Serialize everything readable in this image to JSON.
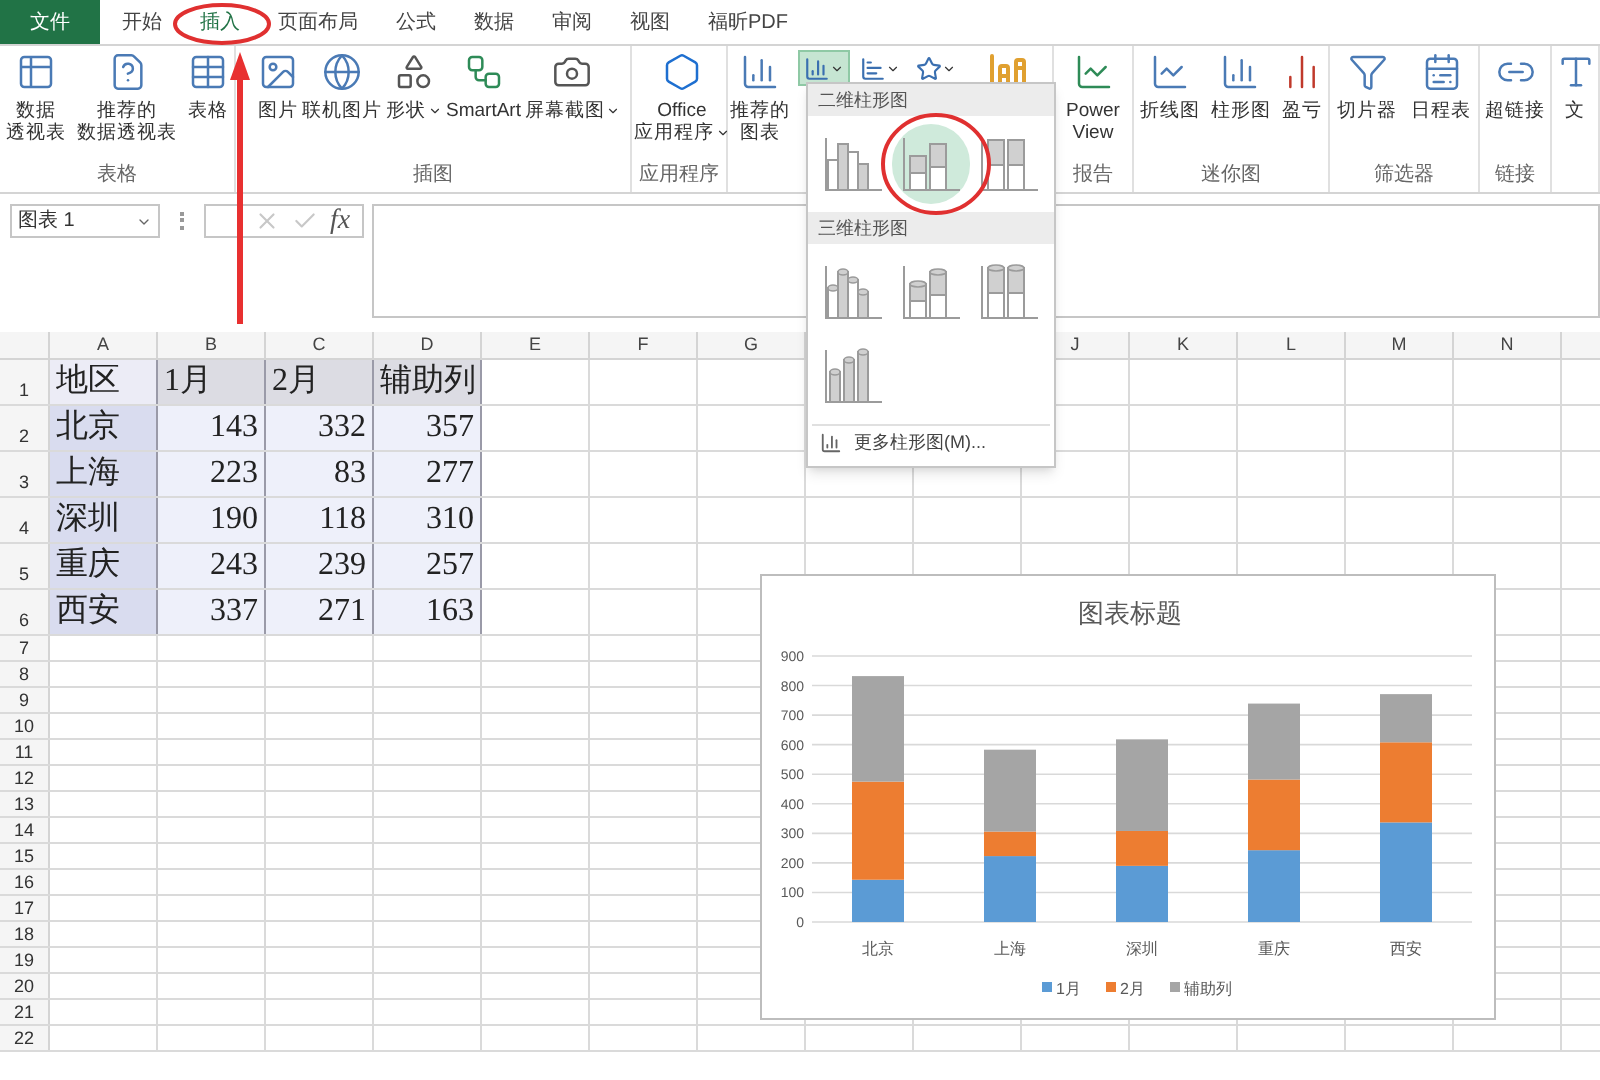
{
  "tabs": [
    {
      "label": "文件",
      "kind": "file",
      "selected": false
    },
    {
      "label": "开始",
      "kind": "tab",
      "selected": false
    },
    {
      "label": "插入",
      "kind": "tab",
      "selected": true
    },
    {
      "label": "页面布局",
      "kind": "tab",
      "selected": false
    },
    {
      "label": "公式",
      "kind": "tab",
      "selected": false
    },
    {
      "label": "数据",
      "kind": "tab",
      "selected": false
    },
    {
      "label": "审阅",
      "kind": "tab",
      "selected": false
    },
    {
      "label": "视图",
      "kind": "tab",
      "selected": false
    },
    {
      "label": "福昕PDF",
      "kind": "tab",
      "selected": false
    }
  ],
  "ribbon": {
    "groups": [
      {
        "kind": "group",
        "caption": "表格",
        "buttons": [
          {
            "lines": [
              "数据",
              "透视表"
            ],
            "dropdown": false
          },
          {
            "lines": [
              "推荐的",
              "数据透视表"
            ],
            "dropdown": false
          },
          {
            "lines": [
              "表格"
            ],
            "dropdown": false
          }
        ]
      },
      {
        "kind": "group",
        "caption": "插图",
        "buttons": [
          {
            "lines": [
              "图片"
            ],
            "dropdown": false
          },
          {
            "lines": [
              "联机图片"
            ],
            "dropdown": false
          },
          {
            "lines": [
              "形状"
            ],
            "dropdown": true
          },
          {
            "lines": [
              "SmartArt"
            ],
            "dropdown": false
          },
          {
            "lines": [
              "屏幕截图"
            ],
            "dropdown": true
          }
        ]
      },
      {
        "kind": "group",
        "caption": "应用程序",
        "buttons": [
          {
            "lines": [
              "Office",
              "应用程序"
            ],
            "dropdown": true
          }
        ]
      },
      {
        "kind": "charts",
        "buttons": [
          {
            "lines": [
              "推荐的",
              "图表"
            ],
            "dropdown": false
          }
        ],
        "small_buttons": [
          {
            "selected": true
          },
          {
            "selected": false
          },
          {
            "selected": false
          }
        ]
      },
      {
        "kind": "group",
        "caption": "报告",
        "buttons": [
          {
            "lines": [
              "Power",
              "View"
            ],
            "dropdown": false
          }
        ]
      },
      {
        "kind": "group",
        "caption": "迷你图",
        "buttons": [
          {
            "lines": [
              "折线图"
            ],
            "dropdown": false
          },
          {
            "lines": [
              "柱形图"
            ],
            "dropdown": false
          },
          {
            "lines": [
              "盈亏"
            ],
            "dropdown": false
          }
        ]
      },
      {
        "kind": "group",
        "caption": "筛选器",
        "buttons": [
          {
            "lines": [
              "切片器"
            ],
            "dropdown": false
          },
          {
            "lines": [
              "日程表"
            ],
            "dropdown": false
          }
        ]
      },
      {
        "kind": "group",
        "caption": "链接",
        "buttons": [
          {
            "lines": [
              "超链接"
            ],
            "dropdown": false
          }
        ]
      },
      {
        "kind": "cut",
        "buttons": [
          {
            "lines": [
              "文"
            ],
            "dropdown": false
          }
        ]
      }
    ]
  },
  "formula_bar": {
    "name_box": "图表 1",
    "function_label": "fx",
    "cancel_disabled": true,
    "enter_disabled": true
  },
  "dropdown": {
    "sections": [
      {
        "title": "二维柱形图",
        "items": [
          {
            "kind": "clustered",
            "selected": false
          },
          {
            "kind": "stacked",
            "selected": true
          },
          {
            "kind": "percent",
            "selected": false
          }
        ]
      },
      {
        "title": "三维柱形图",
        "items": [
          {
            "kind": "clustered3d",
            "selected": false
          },
          {
            "kind": "stacked3d",
            "selected": false
          },
          {
            "kind": "percent3d",
            "selected": false
          },
          {
            "kind": "column3d",
            "selected": false
          }
        ]
      }
    ],
    "more": "更多柱形图(M)..."
  },
  "sheet": {
    "columns_left": [
      "A",
      "B",
      "C",
      "D",
      "E",
      "F",
      "G"
    ],
    "columns_right": [
      "J",
      "K",
      "L",
      "M",
      "N"
    ],
    "rows": [
      {
        "number": "1",
        "kind": "header",
        "cells": [
          "地区",
          "1月",
          "2月",
          "辅助列"
        ]
      },
      {
        "number": "2",
        "kind": "data",
        "cells": [
          "北京",
          "143",
          "332",
          "357"
        ]
      },
      {
        "number": "3",
        "kind": "data",
        "cells": [
          "上海",
          "223",
          "83",
          "277"
        ]
      },
      {
        "number": "4",
        "kind": "data",
        "cells": [
          "深圳",
          "190",
          "118",
          "310"
        ]
      },
      {
        "number": "5",
        "kind": "data",
        "cells": [
          "重庆",
          "243",
          "239",
          "257"
        ]
      },
      {
        "number": "6",
        "kind": "data",
        "cells": [
          "西安",
          "337",
          "271",
          "163"
        ]
      }
    ],
    "empty_rows": [
      "7",
      "8",
      "9",
      "10",
      "11",
      "12",
      "13",
      "14",
      "15",
      "16",
      "17",
      "18",
      "19",
      "20",
      "21",
      "22"
    ]
  },
  "chart": {
    "chart_data": {
      "type": "bar",
      "title": "图表标题",
      "stacked": true,
      "grid": true,
      "legend": true,
      "categories": [
        "北京",
        "上海",
        "深圳",
        "重庆",
        "西安"
      ],
      "series": [
        {
          "name": "1月",
          "color": "#5b9bd5",
          "values": [
            143,
            223,
            190,
            243,
            337
          ]
        },
        {
          "name": "2月",
          "color": "#ed7d31",
          "values": [
            332,
            83,
            118,
            239,
            271
          ]
        },
        {
          "name": "辅助列",
          "color": "#a5a5a5",
          "values": [
            357,
            277,
            310,
            257,
            163
          ]
        }
      ],
      "ylim": [
        0,
        900
      ],
      "yticks": [
        0,
        100,
        200,
        300,
        400,
        500,
        600,
        700,
        800,
        900
      ]
    }
  }
}
